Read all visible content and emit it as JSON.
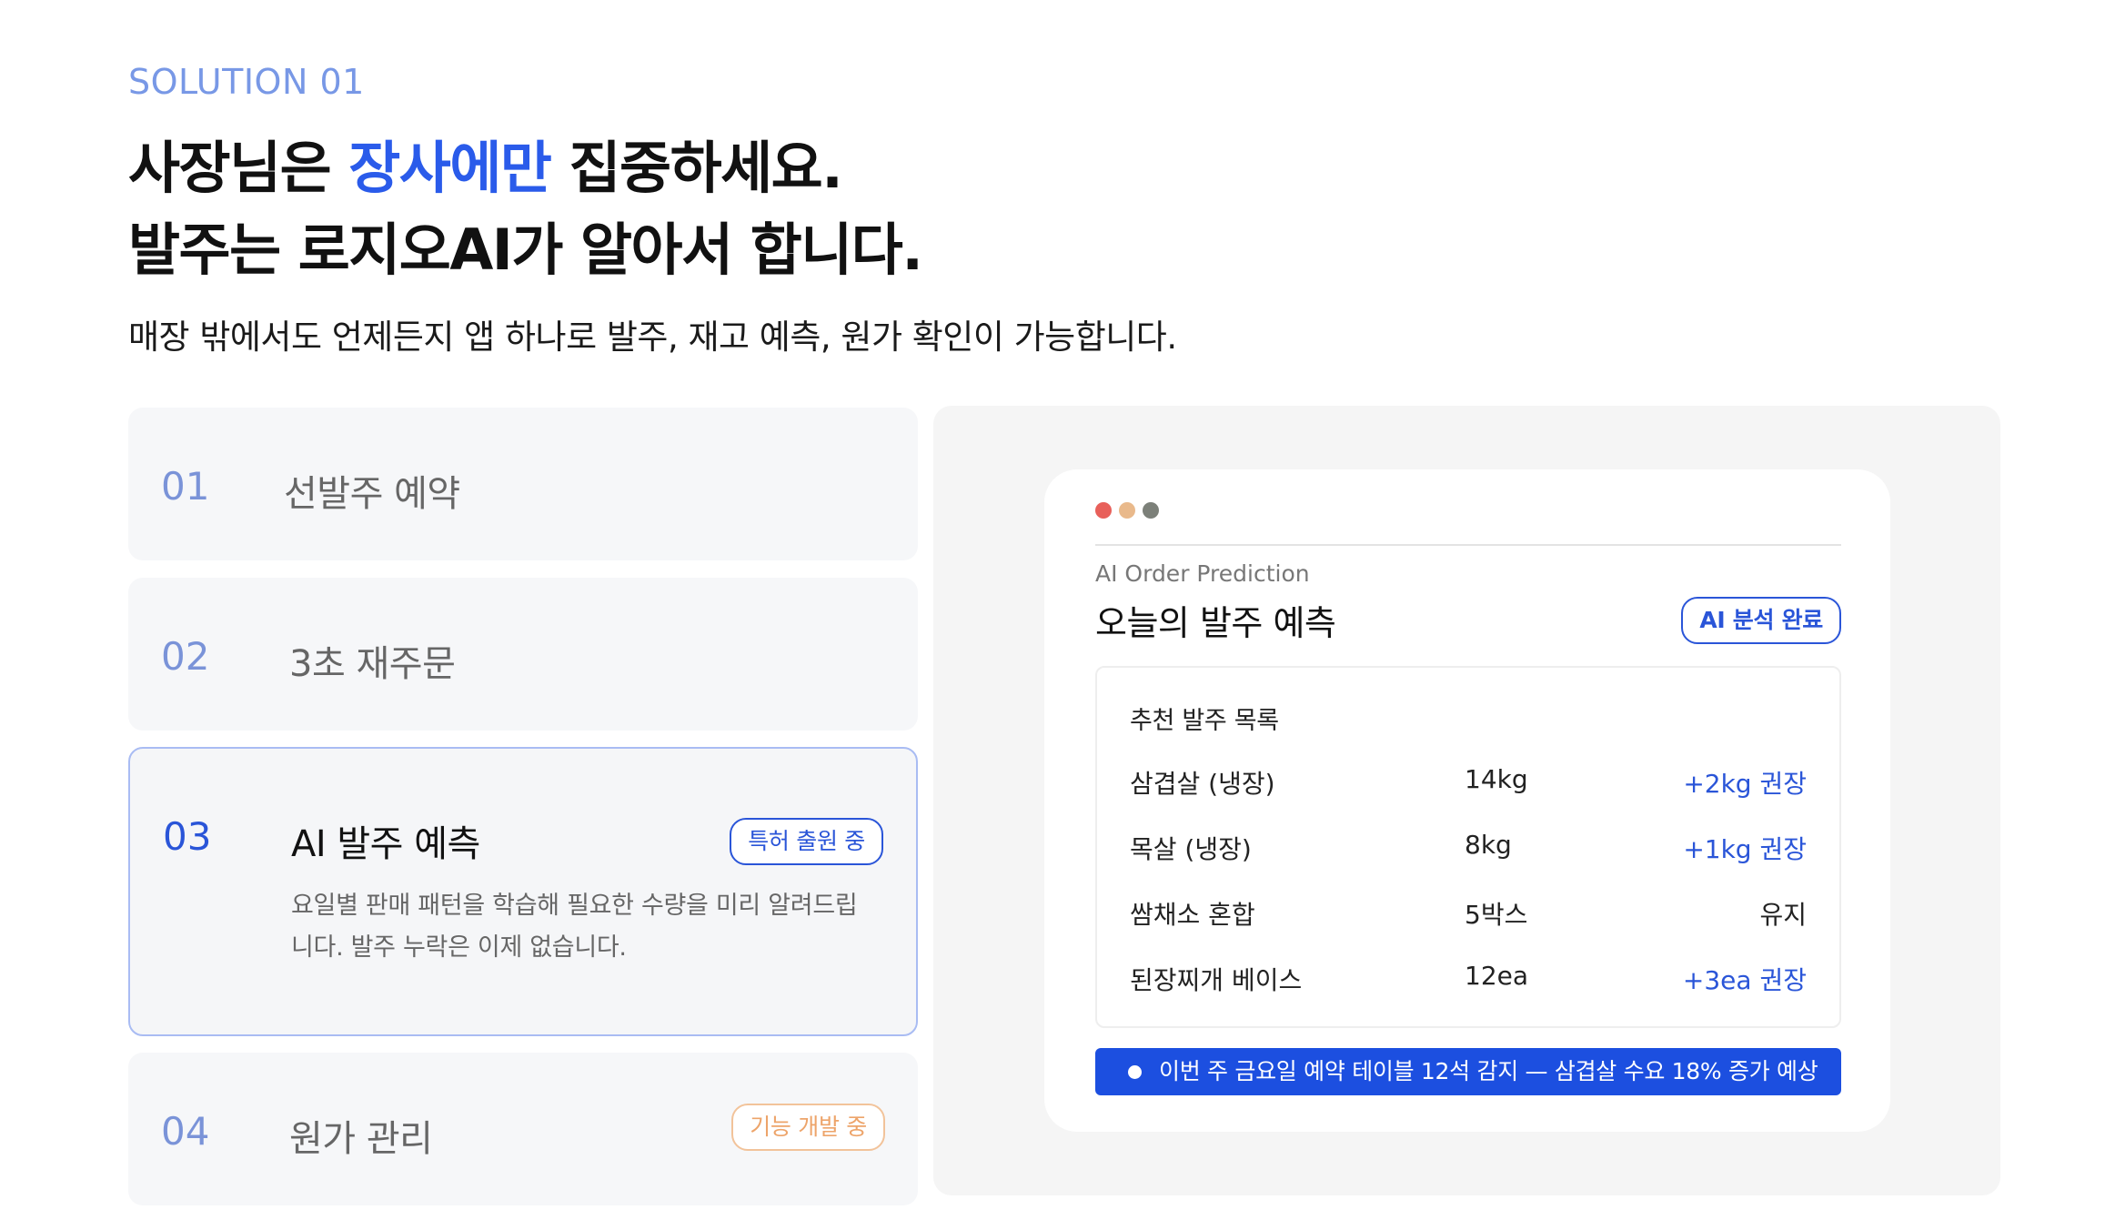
{
  "hero": {
    "eyebrow": "SOLUTION 01",
    "headline_pre": "사장님은 ",
    "headline_accent": "장사에만",
    "headline_post": " 집중하세요.",
    "headline_line2": "발주는 로지오AI가 알아서 합니다.",
    "subhead": "매장 밖에서도 언제든지 앱 하나로 발주, 재고 예측, 원가 확인이 가능합니다."
  },
  "features": [
    {
      "num": "01",
      "title": "선발주 예약"
    },
    {
      "num": "02",
      "title": "3초 재주문"
    },
    {
      "num": "03",
      "title": "AI 발주 예측",
      "badge": "특허 출원 중",
      "desc": "요일별 판매 패턴을 학습해 필요한 수량을 미리 알려드립니다. 발주 누락은 이제 없습니다."
    },
    {
      "num": "04",
      "title": "원가 관리",
      "badge": "기능 개발 중"
    }
  ],
  "card": {
    "dots": [
      "#e8605a",
      "#e9b98b",
      "#7c8079"
    ],
    "label": "AI Order Prediction",
    "title": "오늘의 발주 예측",
    "status": "AI 분석 완료",
    "list_title": "추천 발주 목록",
    "rows": [
      {
        "name": "삼겹살 (냉장)",
        "qty": "14kg",
        "rec": "+2kg 권장"
      },
      {
        "name": "목살 (냉장)",
        "qty": "8kg",
        "rec": "+1kg 권장"
      },
      {
        "name": "쌈채소 혼합",
        "qty": "5박스",
        "rec": "유지"
      },
      {
        "name": "된장찌개 베이스",
        "qty": "12ea",
        "rec": "+3ea 권장"
      }
    ],
    "notice": "이번 주 금요일 예약 테이블 12석 감지 — 삼겹살 수요 18% 증가 예상"
  },
  "colors": {
    "accent": "#2a5bea",
    "notice_bg": "#1c4fe0",
    "badge_orange": "#eda46a"
  }
}
